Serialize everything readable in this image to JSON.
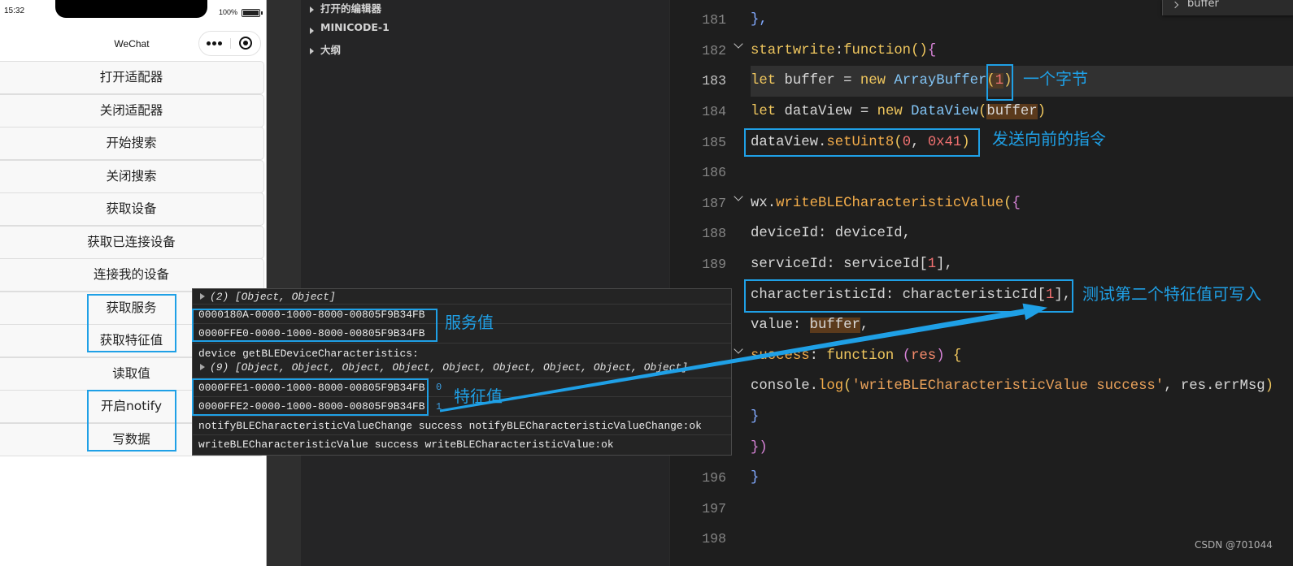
{
  "colors": {
    "annotation": "#1fa0e6",
    "editor_bg": "#1e1e1e",
    "console_bg": "#242424",
    "phone_bg": "#ffffff",
    "button_bg": "#f8f8f8",
    "explorer_bg": "#252526"
  },
  "phone": {
    "status": {
      "time": "15:32",
      "battery": "100%"
    },
    "title": "WeChat",
    "capsule": {
      "more_icon": "more-dots-icon",
      "close_icon": "target-circle-icon"
    },
    "buttons": [
      "打开适配器",
      "关闭适配器",
      "开始搜索",
      "关闭搜索",
      "获取设备",
      "获取已连接设备",
      "连接我的设备",
      "获取服务",
      "获取特征值",
      "读取值",
      "开启notify",
      "写数据"
    ]
  },
  "explorer": {
    "items": [
      {
        "label": "打开的编辑器",
        "icon": "chevron-right-icon"
      },
      {
        "label": "MINICODE-1",
        "icon": "chevron-right-icon"
      },
      {
        "label": "大纲",
        "icon": "chevron-right-icon"
      }
    ]
  },
  "find_widget": {
    "value": "buffer",
    "icon": "chevron-right-icon"
  },
  "editor": {
    "lines": [
      {
        "n": "181",
        "tokens": [
          [
            "},",
            "#82aaff"
          ]
        ]
      },
      {
        "n": "182",
        "fold": true,
        "tokens": [
          [
            "startwrite",
            "#f0c75e"
          ],
          [
            ":",
            "#d8d8d8"
          ],
          [
            "function",
            "#f0c75e"
          ],
          [
            "()",
            "#f0c75e"
          ],
          [
            "{",
            "#d683d6"
          ]
        ]
      },
      {
        "n": "183",
        "current": true,
        "tokens": [
          [
            "let",
            "#f0c75e"
          ],
          [
            " buffer = ",
            "#d8d8d8"
          ],
          [
            "new",
            "#f0c75e"
          ],
          [
            " ",
            "#d8d8d8"
          ],
          [
            "ArrayBuffer",
            "#82c4f5"
          ],
          [
            "(",
            "#f0c75e",
            "#4e3a26"
          ],
          [
            "1",
            "#f07171",
            "#4e3a26"
          ],
          [
            ")",
            "#f0c75e"
          ]
        ]
      },
      {
        "n": "184",
        "tokens": [
          [
            "let",
            "#f0c75e"
          ],
          [
            " dataView = ",
            "#d8d8d8"
          ],
          [
            "new",
            "#f0c75e"
          ],
          [
            " ",
            "#d8d8d8"
          ],
          [
            "DataView",
            "#82c4f5"
          ],
          [
            "(",
            "#f0c75e"
          ],
          [
            "buffer",
            "#d8d8d8",
            "#5b3a1c"
          ],
          [
            ")",
            "#f0c75e"
          ]
        ]
      },
      {
        "n": "185",
        "tokens": [
          [
            "dataView.",
            "#d8d8d8"
          ],
          [
            "setUint8",
            "#f2ac4a"
          ],
          [
            "(",
            "#f0c75e"
          ],
          [
            "0",
            "#f07171"
          ],
          [
            ", ",
            "#d8d8d8"
          ],
          [
            "0x41",
            "#f07171"
          ],
          [
            ")",
            "#f0c75e"
          ]
        ]
      },
      {
        "n": "186",
        "tokens": []
      },
      {
        "n": "187",
        "fold": true,
        "tokens": [
          [
            "wx.",
            "#d8d8d8"
          ],
          [
            "writeBLECharacteristicValue",
            "#f2ac4a"
          ],
          [
            "(",
            "#f0c75e"
          ],
          [
            "{",
            "#d683d6"
          ]
        ]
      },
      {
        "n": "188",
        "tokens": [
          [
            "deviceId: deviceId,",
            "#d8d8d8"
          ]
        ]
      },
      {
        "n": "189",
        "tokens": [
          [
            "serviceId: serviceId",
            "#d8d8d8"
          ],
          [
            "[",
            "#d8d8d8"
          ],
          [
            "1",
            "#f07171"
          ],
          [
            "],",
            "#d8d8d8"
          ]
        ]
      },
      {
        "n": null,
        "tokens": [
          [
            "characteristicId: characteristicId",
            "#d8d8d8"
          ],
          [
            "[",
            "#d8d8d8"
          ],
          [
            "1",
            "#f07171"
          ],
          [
            "],",
            "#d8d8d8"
          ]
        ]
      },
      {
        "n": null,
        "tokens": [
          [
            "value: ",
            "#d8d8d8"
          ],
          [
            "buffer",
            "#d8d8d8",
            "#5b3a1c"
          ],
          [
            ",",
            "#d8d8d8"
          ]
        ]
      },
      {
        "n": null,
        "fold": true,
        "tokens": [
          [
            "success",
            "#f2ac4a"
          ],
          [
            ": ",
            "#d8d8d8"
          ],
          [
            "function",
            "#f0c75e"
          ],
          [
            " ",
            "#d8d8d8"
          ],
          [
            "(",
            "#d683d6"
          ],
          [
            "res",
            "#f78c6c"
          ],
          [
            ")",
            "#d683d6"
          ],
          [
            " {",
            "#f0c75e"
          ]
        ]
      },
      {
        "n": null,
        "tokens": [
          [
            "console.",
            "#d8d8d8"
          ],
          [
            "log",
            "#f2ac4a"
          ],
          [
            "(",
            "#f0c75e"
          ],
          [
            "'writeBLECharacteristicValue success'",
            "#e9a15a"
          ],
          [
            ", res.errMsg",
            "#d8d8d8"
          ],
          [
            ")",
            "#f0c75e"
          ]
        ]
      },
      {
        "n": null,
        "tokens": [
          [
            "}",
            "#82aaff"
          ]
        ]
      },
      {
        "n": null,
        "tokens": [
          [
            "})",
            "#d683d6"
          ]
        ]
      },
      {
        "n": "196",
        "tokens": [
          [
            "}",
            "#82aaff"
          ]
        ]
      },
      {
        "n": "197",
        "tokens": []
      },
      {
        "n": "198",
        "tokens": []
      }
    ]
  },
  "console": {
    "rows": [
      {
        "text": "(2) [Object, Object]",
        "expandable": true
      },
      {
        "text": "0000180A-0000-1000-8000-00805F9B34FB"
      },
      {
        "text": "0000FFE0-0000-1000-8000-00805F9B34FB"
      },
      {
        "text": "device getBLEDeviceCharacteristics:",
        "sub": "(9) [Object, Object, Object, Object, Object, Object, Object, Object, Object]"
      },
      {
        "text": "0000FFE1-0000-1000-8000-00805F9B34FB",
        "index": "0"
      },
      {
        "text": "0000FFE2-0000-1000-8000-00805F9B34FB",
        "index": "1"
      },
      {
        "text": "notifyBLECharacteristicValueChange success notifyBLECharacteristicValueChange:ok"
      },
      {
        "text": "writeBLECharacteristicValue success writeBLECharacteristicValue:ok"
      }
    ]
  },
  "annotations": {
    "one_byte": "一个字节",
    "send_command": "发送向前的指令",
    "second_characteristic_writable": "测试第二个特征值可写入",
    "service_values": "服务值",
    "characteristic_values": "特征值"
  },
  "watermark": "CSDN @701044"
}
